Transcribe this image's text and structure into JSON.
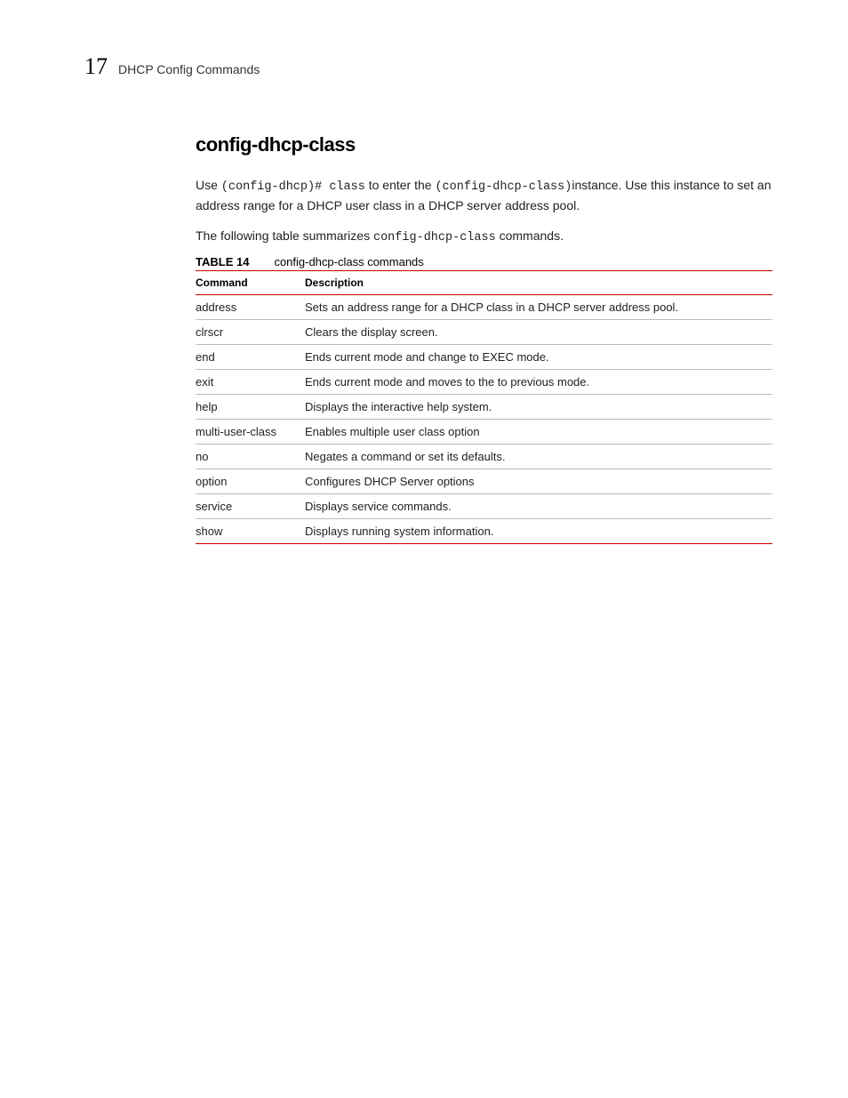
{
  "header": {
    "page_number": "17",
    "title": "DHCP Config Commands"
  },
  "main": {
    "heading": "config-dhcp-class",
    "intro_pre": "Use ",
    "intro_mono1": "(config-dhcp)# class",
    "intro_mid": " to enter the ",
    "intro_mono2": "(config-dhcp-class)",
    "intro_post": "instance. Use this instance to set an address range for a DHCP user class in a DHCP server address pool.",
    "summary_pre": "The following table summarizes ",
    "summary_mono": "config-dhcp-class",
    "summary_post": " commands.",
    "table": {
      "label": "TABLE 14",
      "caption": "config-dhcp-class commands",
      "headers": {
        "col1": "Command",
        "col2": "Description"
      },
      "rows": [
        {
          "cmd": "address",
          "desc": "Sets an address range for a DHCP class in a DHCP server address pool."
        },
        {
          "cmd": "clrscr",
          "desc": "Clears the display screen."
        },
        {
          "cmd": "end",
          "desc": "Ends current mode and change to EXEC mode."
        },
        {
          "cmd": "exit",
          "desc": "Ends current mode and moves to the to previous mode."
        },
        {
          "cmd": "help",
          "desc": "Displays the interactive help system."
        },
        {
          "cmd": "multi-user-class",
          "desc": " Enables multiple user class option"
        },
        {
          "cmd": "no",
          "desc": "Negates a command or set its defaults."
        },
        {
          "cmd": "option",
          "desc": "Configures DHCP Server options"
        },
        {
          "cmd": "service",
          "desc": "Displays service commands."
        },
        {
          "cmd": "show",
          "desc": "Displays running system information."
        }
      ]
    }
  }
}
